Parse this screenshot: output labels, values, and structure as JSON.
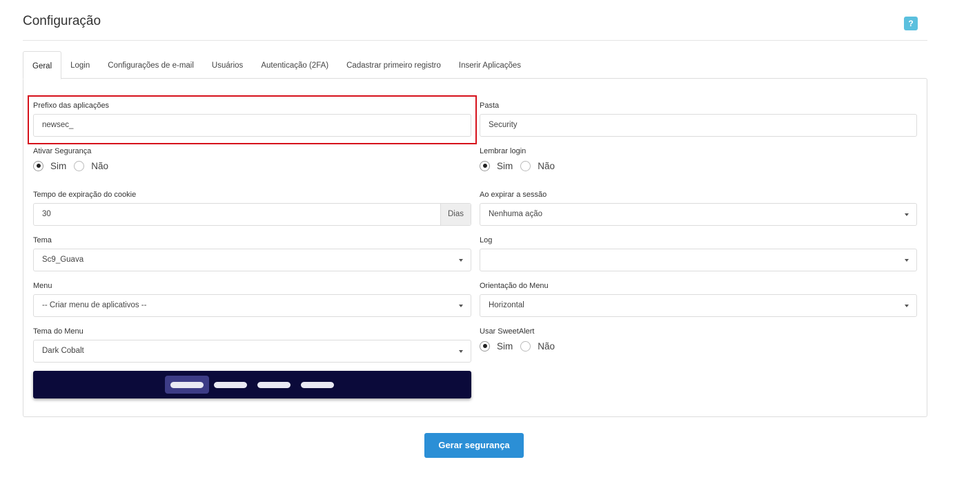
{
  "page": {
    "title": "Configuração",
    "help_label": "?"
  },
  "tabs": [
    {
      "label": "Geral"
    },
    {
      "label": "Login"
    },
    {
      "label": "Configurações de e-mail"
    },
    {
      "label": "Usuários"
    },
    {
      "label": "Autenticação (2FA)"
    },
    {
      "label": "Cadastrar primeiro registro"
    },
    {
      "label": "Inserir Aplicações"
    }
  ],
  "active_tab": "Geral",
  "form": {
    "prefix": {
      "label": "Prefixo das aplicações",
      "value": "newsec_"
    },
    "folder": {
      "label": "Pasta",
      "value": "Security"
    },
    "security": {
      "label": "Ativar Segurança",
      "yes": "Sim",
      "no": "Não",
      "selected": "Sim"
    },
    "remember_login": {
      "label": "Lembrar login",
      "yes": "Sim",
      "no": "Não",
      "selected": "Sim"
    },
    "cookie_expiration": {
      "label": "Tempo de expiração do cookie",
      "value": "30",
      "unit": "Dias"
    },
    "session_expire": {
      "label": "Ao expirar a sessão",
      "value": "Nenhuma ação"
    },
    "theme": {
      "label": "Tema",
      "value": "Sc9_Guava"
    },
    "log": {
      "label": "Log",
      "value": ""
    },
    "menu": {
      "label": "Menu",
      "value": "-- Criar menu de aplicativos --"
    },
    "menu_orientation": {
      "label": "Orientação do Menu",
      "value": "Horizontal"
    },
    "menu_theme": {
      "label": "Tema do Menu",
      "value": "Dark Cobalt"
    },
    "sweetalert": {
      "label": "Usar SweetAlert",
      "yes": "Sim",
      "no": "Não",
      "selected": "Sim"
    }
  },
  "menu_preview": {
    "background": "#0b0a3a",
    "item_count": 4,
    "active_index": 0
  },
  "actions": {
    "submit_label": "Gerar segurança"
  },
  "colors": {
    "accent": "#2b8fd6",
    "help": "#5bc0de",
    "highlight": "#d6111b"
  }
}
